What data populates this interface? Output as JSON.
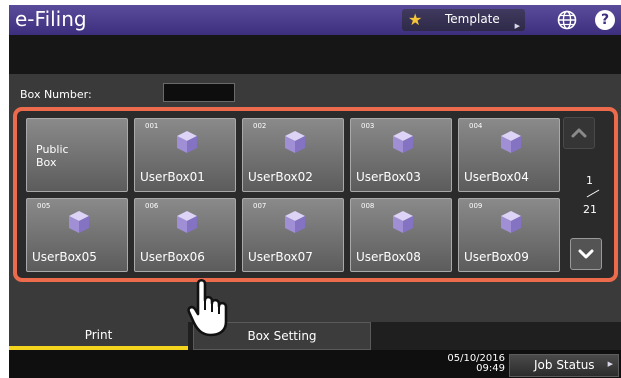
{
  "header": {
    "app_title": "e-Filing",
    "template_label": "Template",
    "icons": [
      "star-icon",
      "globe-icon",
      "help-icon"
    ]
  },
  "box_number": {
    "label": "Box Number:",
    "value": ""
  },
  "boxes": {
    "public": {
      "label": "Public\nBox"
    },
    "items": [
      {
        "number": "001",
        "label": "UserBox01"
      },
      {
        "number": "002",
        "label": "UserBox02"
      },
      {
        "number": "003",
        "label": "UserBox03"
      },
      {
        "number": "004",
        "label": "UserBox04"
      },
      {
        "number": "005",
        "label": "UserBox05"
      },
      {
        "number": "006",
        "label": "UserBox06"
      },
      {
        "number": "007",
        "label": "UserBox07"
      },
      {
        "number": "008",
        "label": "UserBox08"
      },
      {
        "number": "009",
        "label": "UserBox09"
      }
    ]
  },
  "pagination": {
    "current": "1",
    "total": "21"
  },
  "tabs": {
    "print": "Print",
    "box_setting": "Box Setting"
  },
  "status": {
    "date": "05/10/2016",
    "time": "09:49",
    "job_status": "Job Status"
  },
  "colors": {
    "header": "#3d2f7e",
    "highlight_border": "#ec6b4c",
    "active_tab": "#f5d41e",
    "cube": "#b7a4e3",
    "star": "#f5c437"
  }
}
